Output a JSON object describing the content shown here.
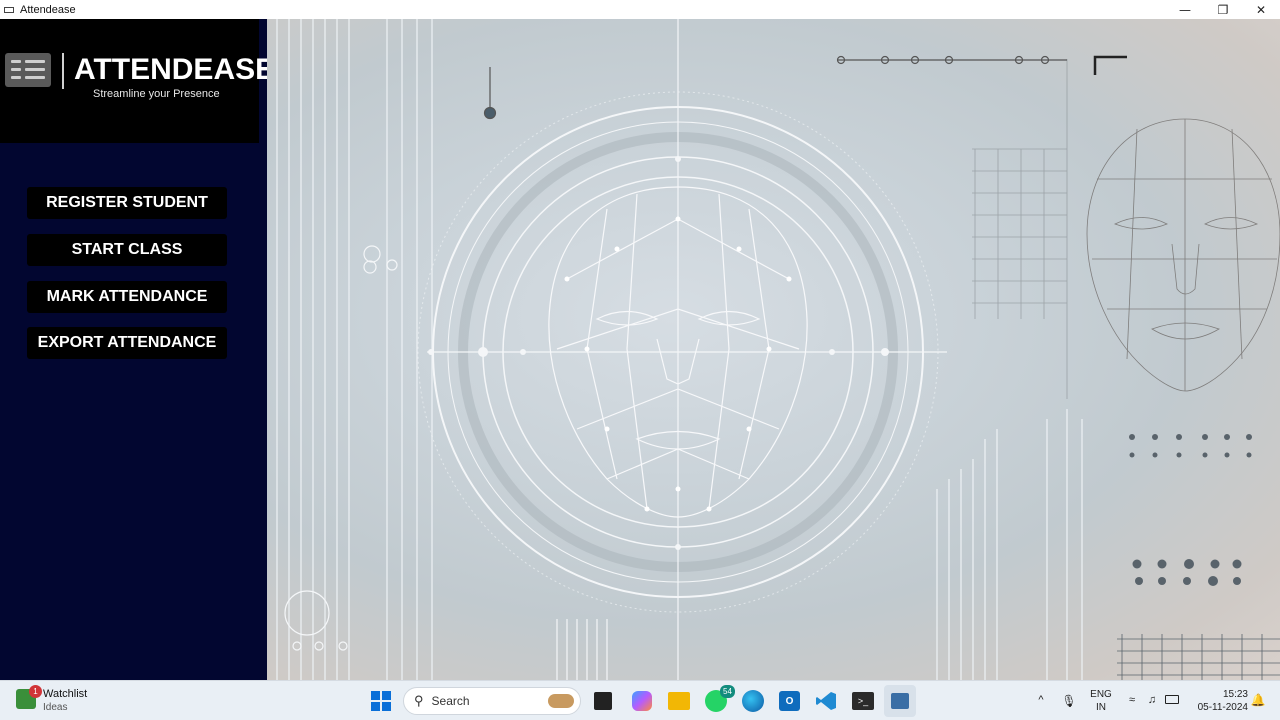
{
  "window": {
    "title": "Attendease",
    "minimize": "—",
    "maximize": "❐",
    "close": "✕"
  },
  "logo": {
    "title": "ATTENDEASE",
    "tagline": "Streamline your Presence"
  },
  "menu": {
    "register": "REGISTER STUDENT",
    "start_class": "START CLASS",
    "mark": "MARK ATTENDANCE",
    "export": "EXPORT ATTENDANCE"
  },
  "taskbar": {
    "widget_title": "Watchlist",
    "widget_sub": "Ideas",
    "widget_badge": "1",
    "search_placeholder": "Search",
    "whatsapp_badge": "54",
    "lang_line1": "ENG",
    "lang_line2": "IN",
    "time": "15:23",
    "date": "05-11-2024"
  },
  "colors": {
    "sidebar_bg": "#020630",
    "button_bg": "#000000",
    "taskbar_bg": "#e9eff5"
  }
}
